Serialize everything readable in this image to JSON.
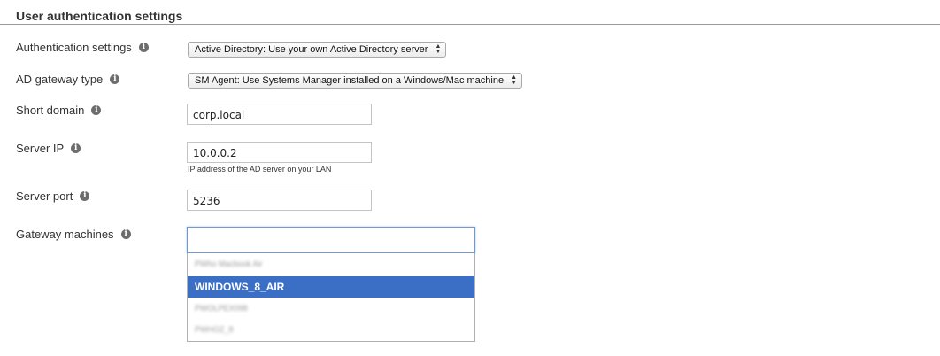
{
  "section": {
    "title": "User authentication settings"
  },
  "fields": {
    "auth_settings": {
      "label": "Authentication settings",
      "value": "Active Directory: Use your own Active Directory server"
    },
    "ad_gateway_type": {
      "label": "AD gateway type",
      "value": "SM Agent: Use Systems Manager installed on a Windows/Mac machine"
    },
    "short_domain": {
      "label": "Short domain",
      "value": "corp.local"
    },
    "server_ip": {
      "label": "Server IP",
      "value": "10.0.0.2",
      "hint": "IP address of the AD server on your LAN"
    },
    "server_port": {
      "label": "Server port",
      "value": "5236"
    },
    "gateway_machines": {
      "label": "Gateway machines",
      "value": "",
      "options": [
        "PWho Macbook Air",
        "WINDOWS_8_AIR",
        "PWOLPEX098",
        "PWHOZ_8"
      ],
      "selected": "WINDOWS_8_AIR"
    }
  },
  "icons": {
    "info": "info-icon",
    "select_arrows": "up-down-arrows-icon"
  },
  "colors": {
    "selection": "#3a6fc5",
    "focus_border": "#6f98d4"
  }
}
